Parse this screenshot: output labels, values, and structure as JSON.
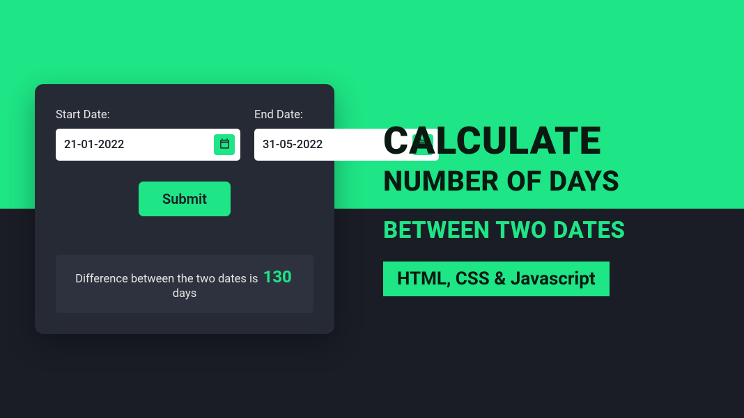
{
  "card": {
    "start_date": {
      "label": "Start Date:",
      "value": "21-01-2022"
    },
    "end_date": {
      "label": "End Date:",
      "value": "31-05-2022"
    },
    "submit_label": "Submit",
    "result": {
      "prefix": "Difference between the two dates is",
      "number": "130",
      "suffix": "days"
    }
  },
  "headline": {
    "line1": "CALCULATE",
    "line2": "NUMBER OF DAYS",
    "line3": "BETWEEN TWO DATES",
    "badge": "HTML, CSS & Javascript"
  }
}
